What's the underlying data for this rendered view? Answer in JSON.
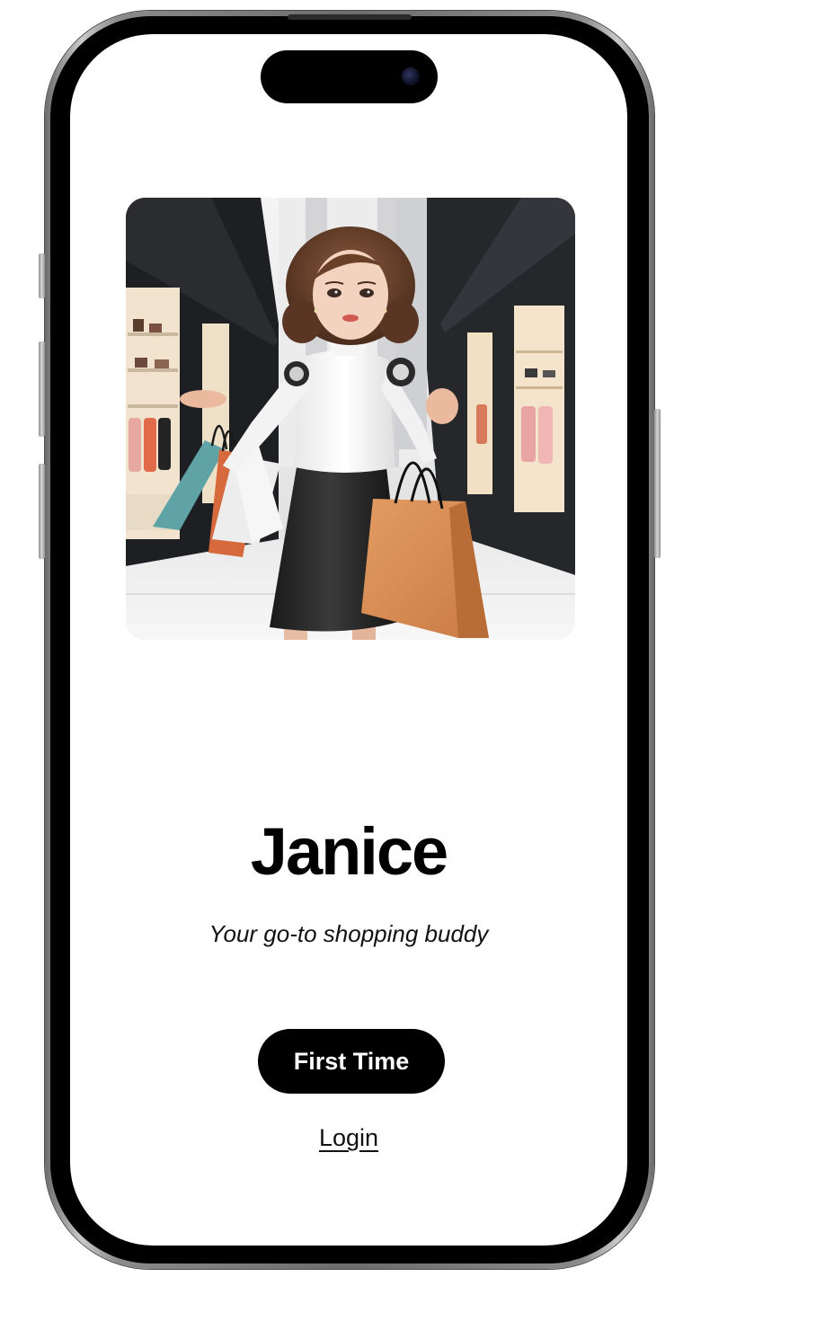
{
  "app": {
    "title": "Janice",
    "tagline": "Your go-to shopping buddy"
  },
  "actions": {
    "first_time_label": "First Time",
    "login_label": "Login"
  },
  "hero": {
    "subject": "robot woman holding shopping bags in a mall corridor",
    "bag_colors": [
      "#5fa3a6",
      "#d76a3c",
      "#eeeeee",
      "#d98c55"
    ]
  },
  "colors": {
    "background": "#ffffff",
    "primary_button": "#000000",
    "primary_button_text": "#ffffff",
    "text": "#000000"
  },
  "icons": {
    "camera": "front-camera-icon"
  }
}
